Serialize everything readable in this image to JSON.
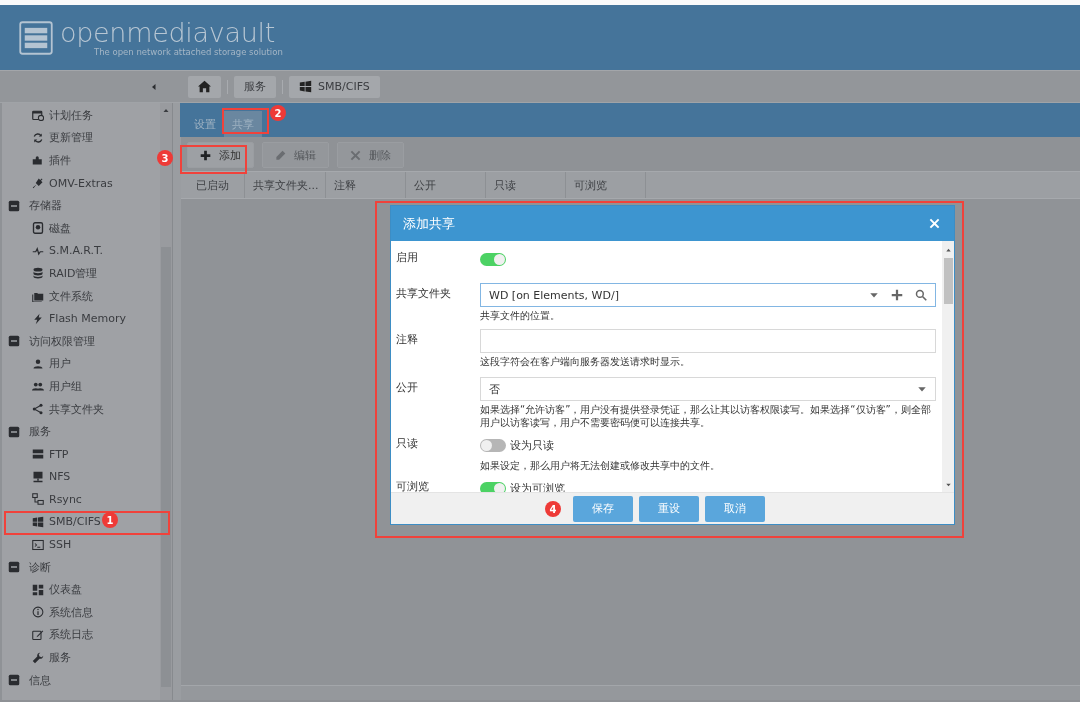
{
  "header": {
    "logo_title": "openmediavault",
    "tagline": "The open network attached storage solution"
  },
  "sidebar": {
    "items": [
      {
        "label": "计划任务"
      },
      {
        "label": "更新管理"
      },
      {
        "label": "插件"
      },
      {
        "label": "OMV-Extras"
      },
      {
        "label": "存储器",
        "expanded": true,
        "children": [
          {
            "label": "磁盘"
          },
          {
            "label": "S.M.A.R.T."
          },
          {
            "label": "RAID管理"
          },
          {
            "label": "文件系统"
          },
          {
            "label": "Flash Memory"
          }
        ]
      },
      {
        "label": "访问权限管理",
        "expanded": true,
        "children": [
          {
            "label": "用户"
          },
          {
            "label": "用户组"
          },
          {
            "label": "共享文件夹"
          }
        ]
      },
      {
        "label": "服务",
        "expanded": true,
        "children": [
          {
            "label": "FTP"
          },
          {
            "label": "NFS"
          },
          {
            "label": "Rsync"
          },
          {
            "label": "SMB/CIFS"
          },
          {
            "label": "SSH"
          }
        ]
      },
      {
        "label": "诊断",
        "expanded": true,
        "children": [
          {
            "label": "仪表盘"
          },
          {
            "label": "系统信息"
          },
          {
            "label": "系统日志"
          },
          {
            "label": "服务"
          }
        ]
      },
      {
        "label": "信息",
        "expanded": true
      }
    ]
  },
  "breadcrumb": [
    "服务",
    "SMB/CIFS"
  ],
  "tabs": [
    {
      "label": "设置",
      "selected": false
    },
    {
      "label": "共享",
      "selected": true
    }
  ],
  "toolbar": [
    {
      "label": "添加",
      "disabled": false
    },
    {
      "label": "编辑",
      "disabled": true
    },
    {
      "label": "删除",
      "disabled": true
    }
  ],
  "table": {
    "columns": [
      "已启动",
      "共享文件夹...",
      "注释",
      "公开",
      "只读",
      "可浏览"
    ]
  },
  "dialog": {
    "title": "添加共享",
    "fields": [
      {
        "kind": "toggle",
        "label": "启用",
        "on": true
      },
      {
        "kind": "combo",
        "label": "共享文件夹",
        "value": "WD [on Elements, WD/]",
        "hint": "共享文件的位置。"
      },
      {
        "kind": "text",
        "label": "注释",
        "hint": "这段字符会在客户端向服务器发送请求时显示。"
      },
      {
        "kind": "select",
        "label": "公开",
        "value": "否",
        "hint": "如果选择“允许访客”，用户没有提供登录凭证，那么让其以访客权限读写。如果选择“仅访客”，则全部用户以访客读写，用户不需要密码便可以连接共享。"
      },
      {
        "kind": "toggle",
        "label": "只读",
        "on": false,
        "toggle_label": "设为只读",
        "hint": "如果设定，那么用户将无法创建或修改共享中的文件。"
      },
      {
        "kind": "toggle",
        "label": "可浏览",
        "on": true,
        "toggle_label": "设为可浏览"
      }
    ],
    "buttons": [
      "保存",
      "重设",
      "取消"
    ]
  },
  "annotations": [
    {
      "number": "1"
    },
    {
      "number": "2"
    },
    {
      "number": "3"
    },
    {
      "number": "4"
    }
  ]
}
